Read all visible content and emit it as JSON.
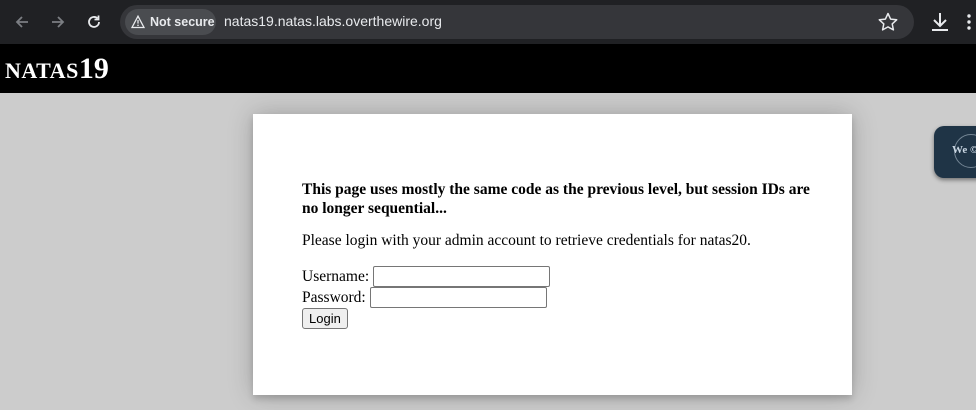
{
  "browser": {
    "security_label": "Not secure",
    "url": "natas19.natas.labs.overthewire.org"
  },
  "page": {
    "title_prefix": "NATAS",
    "title_number": "19",
    "intro_text": "This page uses mostly the same code as the previous level, but session IDs are no longer sequential...",
    "login_message": "Please login with your admin account to retrieve credentials for natas20.",
    "form": {
      "username_label": "Username:",
      "username_value": "",
      "password_label": "Password:",
      "password_value": "",
      "submit_label": "Login"
    },
    "badge_text": "We ©"
  },
  "colors": {
    "chrome_bg": "#202124",
    "omnibox_bg": "#35363a",
    "header_bg": "#000000",
    "page_bg": "#cccccc",
    "card_bg": "#ffffff"
  },
  "icons": [
    "back-arrow-icon",
    "forward-arrow-icon",
    "reload-icon",
    "warning-triangle-icon",
    "bookmark-star-icon",
    "download-icon",
    "menu-dots-icon"
  ]
}
